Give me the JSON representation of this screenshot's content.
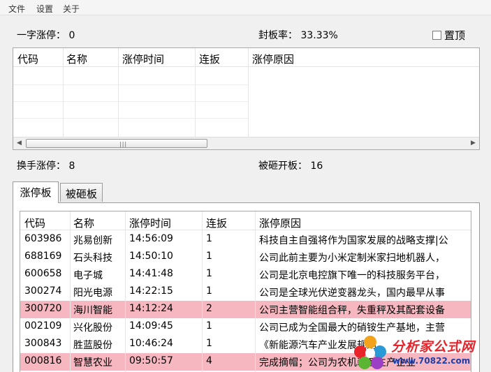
{
  "menu": [
    "文件",
    "设置",
    "关于"
  ],
  "stats": {
    "yizi": "一字涨停： 0",
    "fengban": "封板率： 33.33%",
    "huanshou": "换手涨停： 8",
    "beiza": "被砸开板： 16"
  },
  "pin_label": "置顶",
  "columns": [
    "代码",
    "名称",
    "涨停时间",
    "连扳",
    "涨停原因"
  ],
  "tabs": [
    "涨停板",
    "被砸板"
  ],
  "rows": [
    {
      "code": "603986",
      "name": "兆易创新",
      "time": "14:56:09",
      "lian": "1",
      "reason": "科技自主自强将作为国家发展的战略支撑|公",
      "hl": false
    },
    {
      "code": "688169",
      "name": "石头科技",
      "time": "14:50:10",
      "lian": "1",
      "reason": "公司此前主要为小米定制米家扫地机器人，",
      "hl": false
    },
    {
      "code": "600658",
      "name": "电子城",
      "time": "14:41:48",
      "lian": "1",
      "reason": "公司是北京电控旗下唯一的科技服务平台，",
      "hl": false
    },
    {
      "code": "300274",
      "name": "阳光电源",
      "time": "14:22:15",
      "lian": "1",
      "reason": "公司是全球光伏逆变器龙头，国内最早从事",
      "hl": false
    },
    {
      "code": "300720",
      "name": "海川智能",
      "time": "14:12:24",
      "lian": "2",
      "reason": "公司主营智能组合秤，失重秤及其配套设备",
      "hl": true
    },
    {
      "code": "002109",
      "name": "兴化股份",
      "time": "14:09:45",
      "lian": "1",
      "reason": "公司已成为全国最大的硝铵生产基地，主营",
      "hl": false
    },
    {
      "code": "300843",
      "name": "胜蓝股份",
      "time": "10:46:24",
      "lian": "1",
      "reason": "《新能源汽车产业发展规划",
      "hl": false
    },
    {
      "code": "000816",
      "name": "智慧农业",
      "time": "09:50:57",
      "lian": "4",
      "reason": "完成摘帽；公司为农机装备生产企业",
      "hl": true
    }
  ],
  "watermark": {
    "title": "分析家公式网",
    "url": "www.70822.com"
  }
}
